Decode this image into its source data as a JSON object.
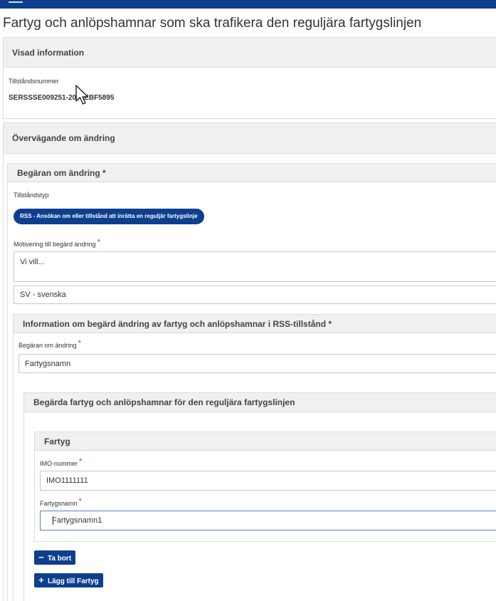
{
  "page": {
    "title": "Fartyg och anlöpshamnar som ska trafikera den reguljära fartygslinjen"
  },
  "shown_info": {
    "heading": "Visad information",
    "permit_number_label": "Tillståndsnummer",
    "permit_number_value": "SERSSSE009251-20    EBF5895"
  },
  "considerations": {
    "heading": "Övervägande om ändring"
  },
  "request": {
    "heading": "Begäran om ändring *",
    "permit_type_label": "Tillståndstyp",
    "permit_type_value": "RSS - Ansökan om eller tillstånd att inrätta en reguljär fartygslinje",
    "motivation_label": "Motivering till begärd ändring",
    "motivation_value": "Vi vill...",
    "language_value": "SV - svenska"
  },
  "rss_change": {
    "heading": "Information om begärd ändring av fartyg och anlöpshamnar i RSS-tillstånd *",
    "change_label": "Begäran om ändring",
    "change_value": "Fartygsnamn"
  },
  "requested_ships": {
    "heading": "Begärda fartyg och anlöpshamnar för den reguljära fartygslinjen",
    "ship": {
      "heading": "Fartyg",
      "imo_label": "IMO-nummer",
      "imo_value": "IMO1111111",
      "name_label": "Fartygsnamn",
      "name_value": "Fartygsnamn1"
    },
    "remove_label": "Ta bort",
    "add_label": "Lägg till Fartyg"
  },
  "colors": {
    "brand": "#0e3f8f",
    "required": "#d32f2f"
  }
}
